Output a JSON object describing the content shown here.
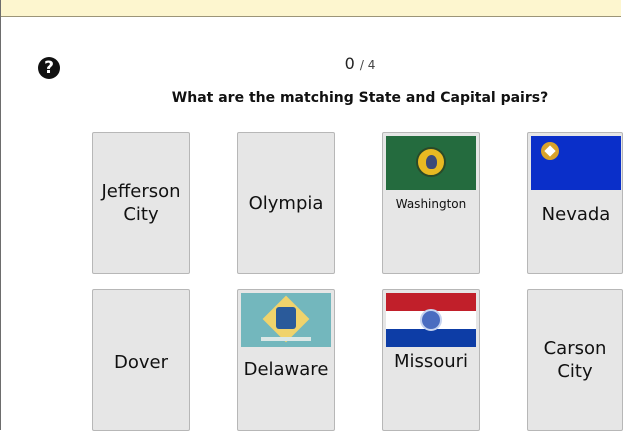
{
  "game": {
    "score": "0",
    "score_total": "/ 4",
    "question": "What are the matching State and Capital pairs?",
    "help_icon": "question-circle-icon"
  },
  "cards": {
    "jefferson_city": "Jefferson City",
    "olympia": "Olympia",
    "washington": "Washington",
    "nevada": "Nevada",
    "dover": "Dover",
    "delaware": "Delaware",
    "missouri": "Missouri",
    "carson_city": "Carson City"
  },
  "colors": {
    "banner": "#fdf6cf",
    "card_bg": "#e6e6e6"
  }
}
